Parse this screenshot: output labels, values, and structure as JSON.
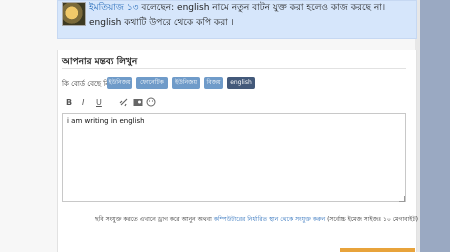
{
  "comment": {
    "author": "ইমতিয়াজ ১৩",
    "text": " বলেছেন: english নামে নতুন বাটন যুক্ত করা হলেও কাজ করছে না। english কথাটি উপরে থেকে কপি করা ।"
  },
  "comment_form": {
    "title": "আপনার মন্তব্য লিখুন",
    "script_label": "কি বোর্ড বেছে নিন:",
    "languages": [
      {
        "label": "ইউনিজয়",
        "active": false
      },
      {
        "label": "ফোনেটিক",
        "active": false
      },
      {
        "label": "ইউনিজয়",
        "active": false
      },
      {
        "label": "বিজয়",
        "active": false
      },
      {
        "label": "english",
        "active": true
      }
    ],
    "toolbar": [
      "bold-icon",
      "italic-icon",
      "underline-icon",
      "link-icon",
      "image-icon",
      "emoji-icon"
    ],
    "editor_value": "i am writing in english",
    "upload_note_prefix": "ছবি সংযুক্ত করতে এখানে ড্রাগ করে আনুন অথবা ",
    "upload_note_link": "কম্পিউটারের নির্ধারিত স্থান থেকে সংযুক্ত করুন",
    "upload_note_suffix": " (সর্বোচ্চ ইমেজ সাইজঃ ১০ মেগাবাইট)"
  }
}
